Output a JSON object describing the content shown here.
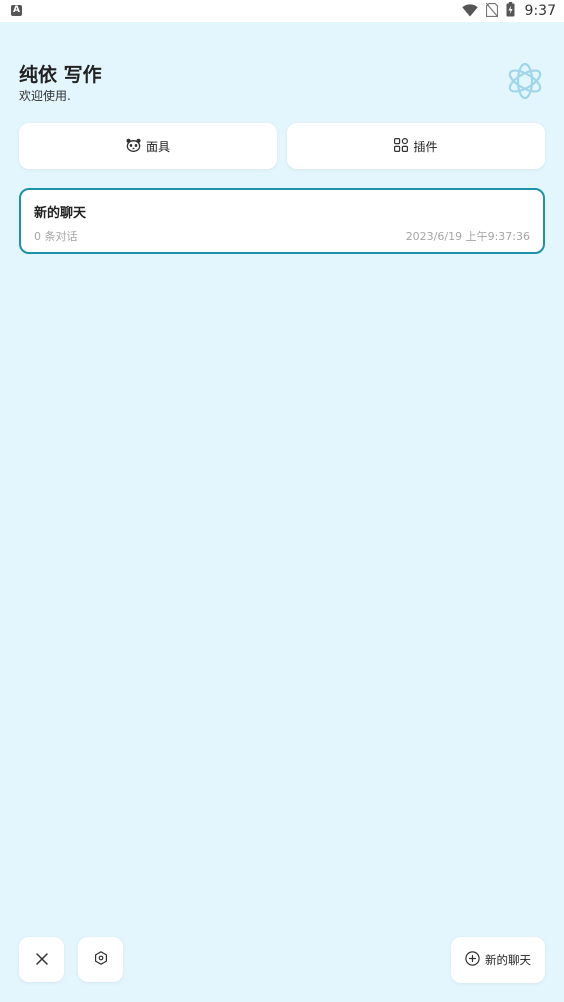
{
  "status_bar": {
    "left_icon": "A",
    "time": "9:37",
    "icons": [
      "wifi-icon",
      "no-sim-icon",
      "battery-charging-icon"
    ]
  },
  "header": {
    "title": "纯依 写作",
    "subtitle": "欢迎使用.",
    "logo_icon": "openai-logo-icon"
  },
  "top_buttons": {
    "mask_label": "面具",
    "mask_icon": "mask-icon",
    "plugin_label": "插件",
    "plugin_icon": "plugin-grid-icon"
  },
  "chats": [
    {
      "title": "新的聊天",
      "count": "0 条对话",
      "time": "2023/6/19 上午9:37:36"
    }
  ],
  "bottom_bar": {
    "close_icon": "close-icon",
    "settings_icon": "settings-icon",
    "new_chat_label": "新的聊天",
    "new_chat_icon": "add-circle-icon"
  },
  "colors": {
    "background": "#e3f5fd",
    "accent": "#1d93ab",
    "card": "#ffffff",
    "muted_text": "#a6a6a6"
  }
}
